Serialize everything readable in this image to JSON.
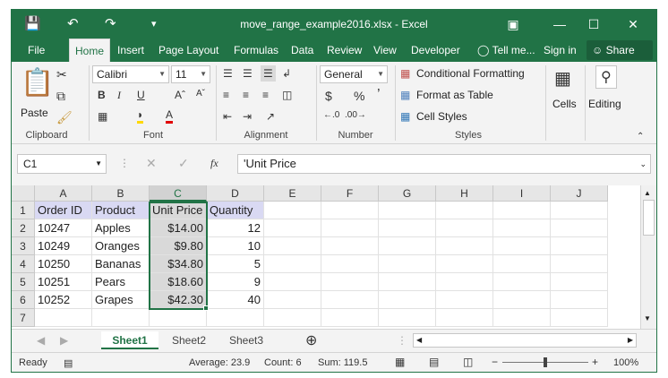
{
  "window": {
    "title": "move_range_example2016.xlsx - Excel",
    "accent": "#217346"
  },
  "tabs": [
    "File",
    "Home",
    "Insert",
    "Page Layout",
    "Formulas",
    "Data",
    "Review",
    "View",
    "Developer",
    "Tell me...",
    "Sign in",
    "Share"
  ],
  "active_tab": "Home",
  "ribbon": {
    "groups": [
      "Clipboard",
      "Font",
      "Alignment",
      "Number",
      "Styles"
    ],
    "paste_label": "Paste",
    "font_name": "Calibri",
    "font_size": "11",
    "number_format": "General",
    "conditional_formatting": "Conditional Formatting",
    "format_as_table": "Format as Table",
    "cell_styles": "Cell Styles",
    "cells_label": "Cells",
    "editing_label": "Editing"
  },
  "formula_bar": {
    "name_box": "C1",
    "fx": "fx",
    "formula": "'Unit Price"
  },
  "columns": [
    "A",
    "B",
    "C",
    "D",
    "E",
    "F",
    "G",
    "H",
    "I",
    "J"
  ],
  "selected_column": "C",
  "rows": [
    {
      "num": "1",
      "cells": [
        "Order ID",
        "Product",
        "Unit Price",
        "Quantity"
      ]
    },
    {
      "num": "2",
      "cells": [
        "10247",
        "Apples",
        "$14.00",
        "12"
      ]
    },
    {
      "num": "3",
      "cells": [
        "10249",
        "Oranges",
        "$9.80",
        "10"
      ]
    },
    {
      "num": "4",
      "cells": [
        "10250",
        "Bananas",
        "$34.80",
        "5"
      ]
    },
    {
      "num": "5",
      "cells": [
        "10251",
        "Pears",
        "$18.60",
        "9"
      ]
    },
    {
      "num": "6",
      "cells": [
        "10252",
        "Grapes",
        "$42.30",
        "40"
      ]
    },
    {
      "num": "7",
      "cells": [
        "",
        "",
        "",
        ""
      ]
    }
  ],
  "sheets": [
    "Sheet1",
    "Sheet2",
    "Sheet3"
  ],
  "active_sheet": "Sheet1",
  "status": {
    "ready": "Ready",
    "average": "Average: 23.9",
    "count": "Count: 6",
    "sum": "Sum: 119.5",
    "zoom": "100%"
  }
}
